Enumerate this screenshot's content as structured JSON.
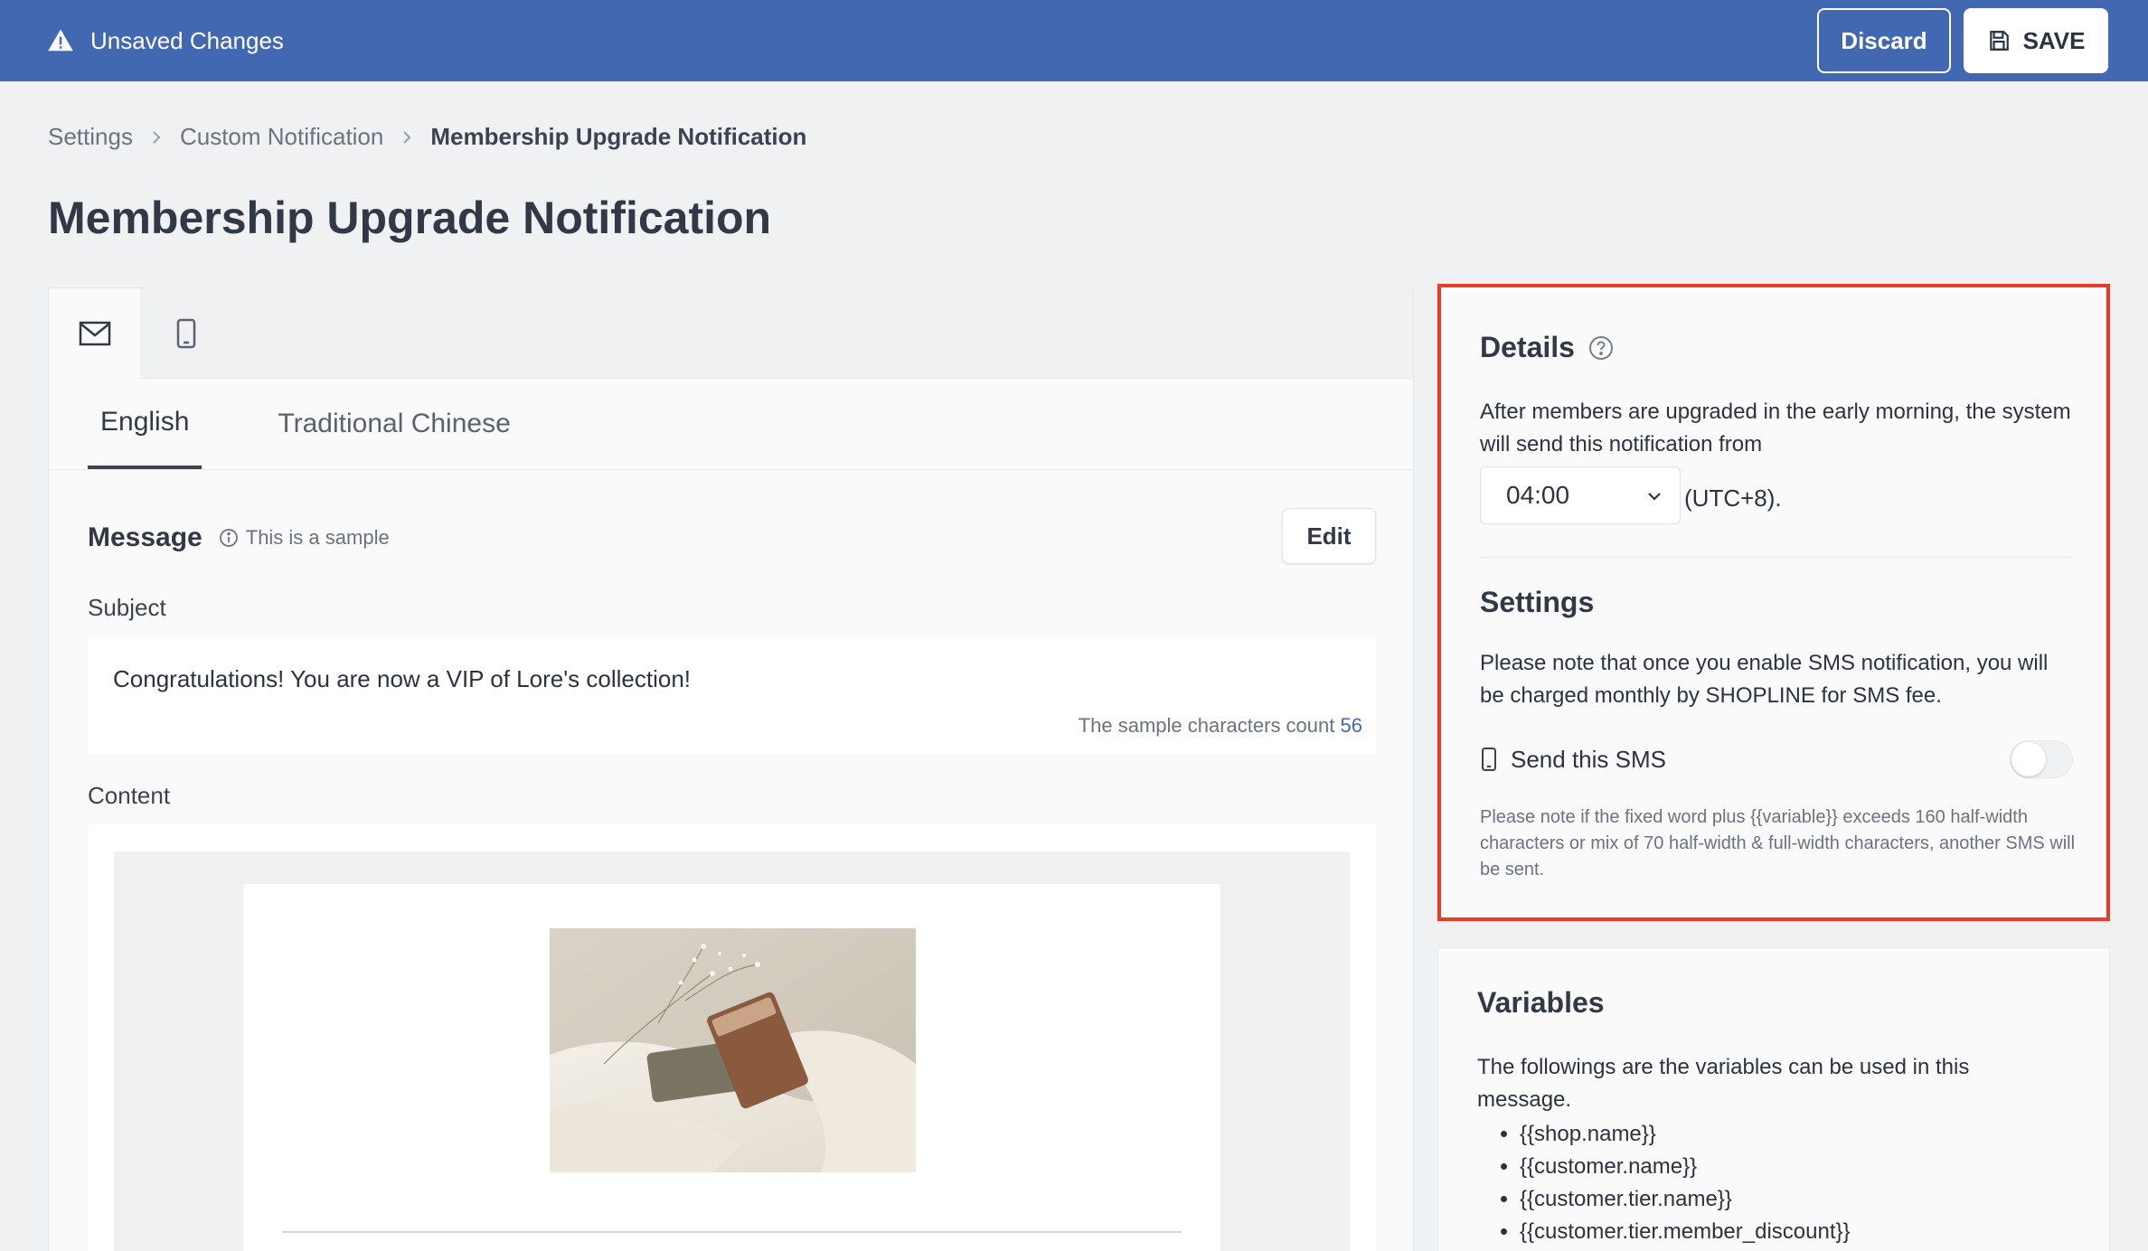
{
  "topbar": {
    "status_text": "Unsaved Changes",
    "discard_label": "Discard",
    "save_label": "SAVE",
    "bg_color": "#4268b2"
  },
  "breadcrumb": {
    "items": [
      "Settings",
      "Custom Notification"
    ],
    "current": "Membership Upgrade Notification"
  },
  "page": {
    "title": "Membership Upgrade Notification"
  },
  "channel_tabs": [
    {
      "icon": "mail-icon",
      "active": true
    },
    {
      "icon": "mobile-icon",
      "active": false
    }
  ],
  "language_tabs": [
    {
      "label": "English",
      "active": true
    },
    {
      "label": "Traditional Chinese",
      "active": false
    }
  ],
  "message": {
    "title": "Message",
    "sample_note": "This is a sample",
    "edit_label": "Edit",
    "subject_label": "Subject",
    "subject_value": "Congratulations! You are now a VIP of Lore's collection!",
    "count_label": "The sample characters count",
    "count_value": "56",
    "content_label": "Content"
  },
  "details": {
    "title": "Details",
    "description": "After members are upgraded in the early morning, the system will send this notification from",
    "time_value": "04:00",
    "timezone": "(UTC+8).",
    "highlight_color": "#e53d2a"
  },
  "settings": {
    "title": "Settings",
    "description": "Please note that once you enable SMS notification, you will be charged monthly by SHOPLINE for SMS fee.",
    "sms_label": "Send this SMS",
    "sms_enabled": false,
    "note": "Please note if the fixed word plus {{variable}} exceeds 160 half-width characters or mix of 70 half-width & full-width characters, another SMS will be sent."
  },
  "variables": {
    "title": "Variables",
    "description": "The followings are the variables can be used in this message.",
    "items": [
      "{{shop.name}}",
      "{{customer.name}}",
      "{{customer.tier.name}}",
      "{{customer.tier.member_discount}}"
    ]
  }
}
